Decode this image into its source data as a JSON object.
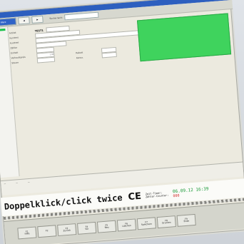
{
  "toolbar": {
    "primary": "Ware",
    "search_label": "Suche nach:"
  },
  "form": {
    "artikel_label": "Artikel",
    "artikel_value": "TEST1",
    "kurztext_label": "Kurztext",
    "langtext_label": "Kurztext",
    "zahler_label": "Zähler",
    "einheit_label": "Einheit",
    "preis_label": "Verkaufspreis",
    "preis_value": "1,00",
    "rabatt_label": "Rabatt",
    "steuer_label": "Steuer",
    "kennz_label": "Kennz."
  },
  "banner": {
    "instruction": "Doppelklick/click twice",
    "ce_mark": "CE",
    "zeit_label": "Zeit-Timer:",
    "counter_label": "Zähler-Counter:",
    "date_value": "06.09.12 16:39",
    "counter_value": "000"
  },
  "fkeys": [
    {
      "key": "F1",
      "label": "Hilfe"
    },
    {
      "key": "F2",
      "label": ""
    },
    {
      "key": "F3",
      "label": "Zurück"
    },
    {
      "key": "F4",
      "label": "Vor"
    },
    {
      "key": "F5",
      "label": "Neu"
    },
    {
      "key": "F6",
      "label": "Löschen"
    },
    {
      "key": "F7",
      "label": "Speichern"
    },
    {
      "key": "F8",
      "label": "Drucken"
    },
    {
      "key": "F9",
      "label": "Ende"
    }
  ],
  "colors": {
    "accent": "#2f63c8",
    "highlight": "#3fd35d",
    "counter": "#d03131",
    "date": "#1a9a38"
  }
}
